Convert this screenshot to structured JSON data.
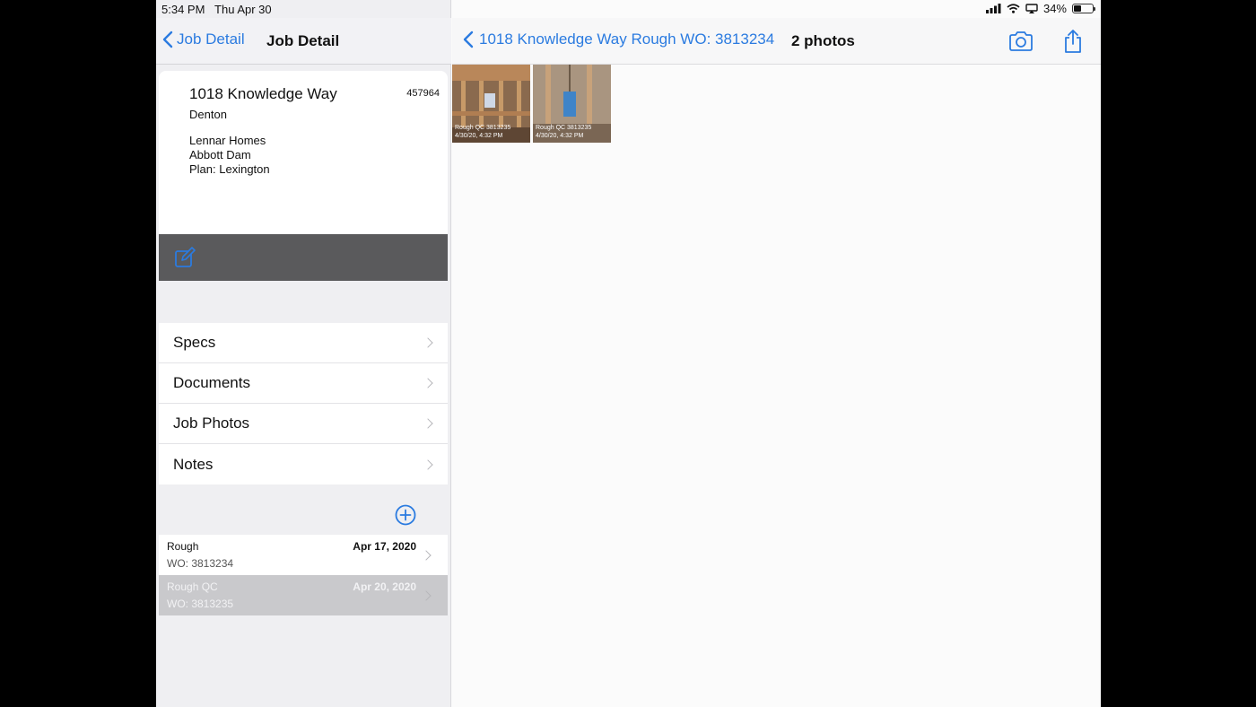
{
  "status": {
    "time": "5:34 PM",
    "date": "Thu Apr 30",
    "battery": "34%"
  },
  "master": {
    "back_label": "Job Detail",
    "title": "Job Detail",
    "job": {
      "address": "1018 Knowledge Way",
      "number": "457964",
      "city": "Denton",
      "builder": "Lennar Homes",
      "subdivision": "Abbott Dam",
      "plan": "Plan: Lexington"
    },
    "menu": [
      {
        "label": "Specs"
      },
      {
        "label": "Documents"
      },
      {
        "label": "Job Photos"
      },
      {
        "label": "Notes"
      }
    ],
    "work_orders": [
      {
        "name": "Rough",
        "wo": "WO: 3813234",
        "date": "Apr 17, 2020"
      },
      {
        "name": "Rough QC",
        "wo": "WO: 3813235",
        "date": "Apr 20, 2020"
      }
    ]
  },
  "detail": {
    "back_label": "1018 Knowledge Way Rough WO: 3813234",
    "photo_count": "2 photos",
    "photos": [
      {
        "caption_1": "Rough QC 3813235",
        "caption_2": "4/30/20, 4:32 PM"
      },
      {
        "caption_1": "Rough QC 3813235",
        "caption_2": "4/30/20, 4:32 PM"
      }
    ]
  },
  "colors": {
    "accent": "#2b7be0",
    "edit_bar": "#5a5a5c",
    "selected_row": "#c9c9cc"
  },
  "icons": [
    "chevron-left-icon",
    "edit-icon",
    "chevron-right-icon",
    "add-circle-icon",
    "camera-icon",
    "share-icon",
    "wifi-icon",
    "cellular-icon",
    "screen-mirror-icon",
    "battery-icon"
  ]
}
